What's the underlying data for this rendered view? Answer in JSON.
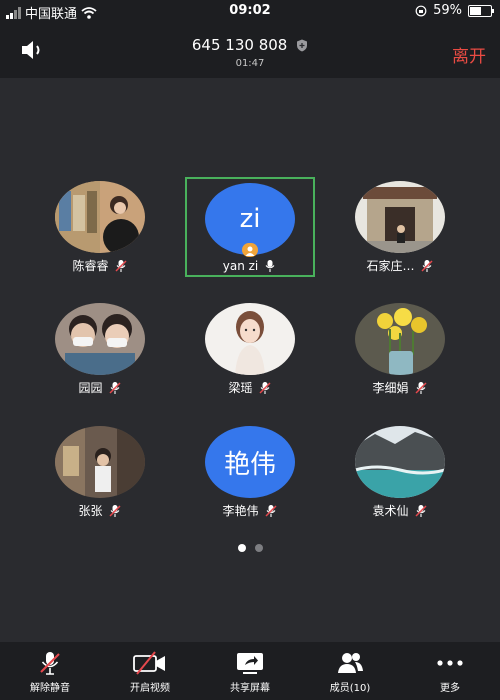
{
  "status": {
    "carrier": "中国联通",
    "time": "09:02",
    "battery": "59%",
    "battery_level": 0.59
  },
  "header": {
    "meeting_id": "645 130 808",
    "timer": "01:47",
    "leave_label": "离开"
  },
  "participants": [
    {
      "name": "陈睿睿",
      "avatar_text": "",
      "mic": "muted"
    },
    {
      "name": "yan zi",
      "avatar_text": "zi",
      "mic": "on",
      "active": true,
      "host": true
    },
    {
      "name": "石家庄…",
      "avatar_text": "",
      "mic": "muted"
    },
    {
      "name": "园园",
      "avatar_text": "",
      "mic": "muted"
    },
    {
      "name": "梁瑶",
      "avatar_text": "",
      "mic": "muted"
    },
    {
      "name": "李细娟",
      "avatar_text": "",
      "mic": "muted"
    },
    {
      "name": "张张",
      "avatar_text": "",
      "mic": "muted"
    },
    {
      "name": "李艳伟",
      "avatar_text": "艳伟",
      "mic": "muted"
    },
    {
      "name": "袁术仙",
      "avatar_text": "",
      "mic": "muted"
    }
  ],
  "pager": {
    "pages": 2,
    "current": 1
  },
  "toolbar": {
    "unmute": "解除静音",
    "video": "开启视频",
    "share": "共享屏幕",
    "members": "成员(10)",
    "more": "更多"
  },
  "colors": {
    "background": "#2a2b2f",
    "bar": "#1d1e21",
    "avatar_blue": "#3577ec",
    "active_border": "#49b15c",
    "leave_red": "#e94b43",
    "mute_red": "#e5484d"
  }
}
